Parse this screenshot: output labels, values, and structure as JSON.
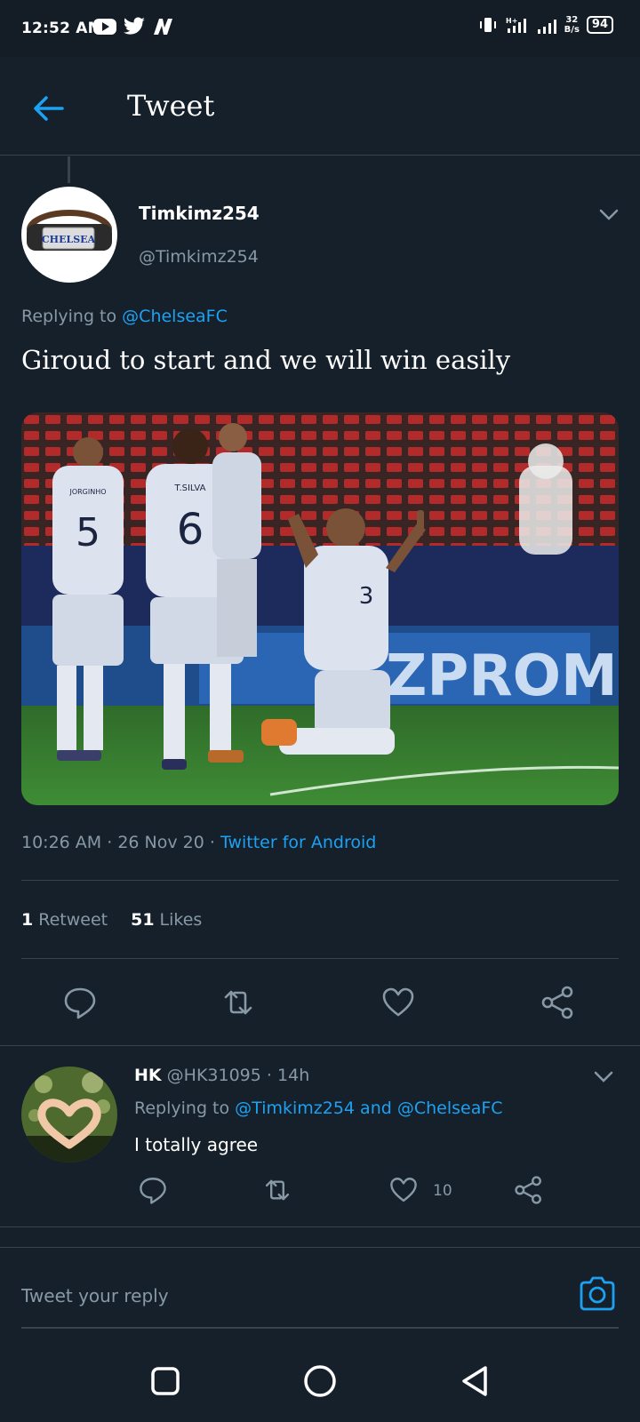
{
  "status_bar": {
    "time": "12:52 AM",
    "app_icons": [
      "youtube-icon",
      "twitter-icon",
      "news-icon"
    ],
    "net_speed_value": "32",
    "net_speed_unit": "B/s",
    "battery": "94"
  },
  "header": {
    "title": "Tweet",
    "back_icon": "back-arrow-icon"
  },
  "tweet": {
    "display_name": "Timkimz254",
    "handle": "@Timkimz254",
    "avatar_badge": "CHELSEA",
    "replying_prefix": "Replying to",
    "replying_to": "@ChelseaFC",
    "text": "Giroud to start and we will win easily",
    "time": "10:26 AM",
    "date": "26 Nov 20",
    "source": "Twitter for Android",
    "retweets_count": "1",
    "retweets_label": "Retweet",
    "likes_count": "51",
    "likes_label": "Likes",
    "media": {
      "jersey_name_1": "JORGINHO",
      "jersey_number_1": "5",
      "jersey_name_2": "T.SILVA",
      "jersey_number_2": "6",
      "jersey_number_3": "3",
      "ad_board": "ZPROM"
    }
  },
  "reply": {
    "display_name": "HK",
    "handle": "@HK31095",
    "time": "14h",
    "replying_prefix": "Replying to",
    "replying_to": "@Timkimz254 and @ChelseaFC",
    "text": "I totally agree",
    "likes": "10"
  },
  "compose": {
    "placeholder": "Tweet your reply"
  },
  "colors": {
    "background": "#15202b",
    "accent": "#1da1f2",
    "secondary_text": "#8899a6",
    "border": "#38444d"
  }
}
